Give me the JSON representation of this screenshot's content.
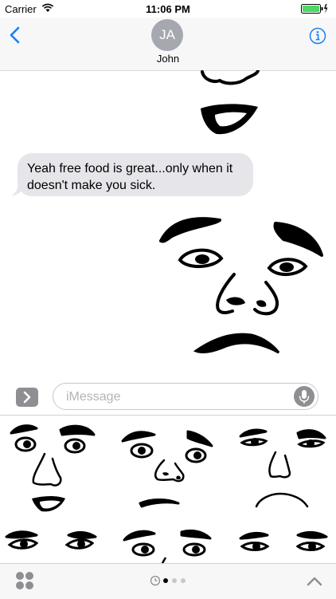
{
  "status_bar": {
    "carrier": "Carrier",
    "time": "11:06 PM"
  },
  "nav": {
    "avatar_initials": "JA",
    "contact_name": "John"
  },
  "messages": [
    {
      "from": "contact",
      "text": "Yeah free food is great...only when it doesn't make you sick."
    }
  ],
  "input": {
    "placeholder": "iMessage"
  },
  "icons": {
    "back": "chevron-left-icon",
    "info": "info-icon",
    "apps": "chevron-right-icon",
    "mic": "microphone-icon",
    "grid": "app-grid-icon",
    "recents": "clock-icon",
    "expand": "chevron-up-icon"
  },
  "colors": {
    "accent": "#1a7ef7",
    "bubble": "#e5e5ea",
    "battery": "#4cd964"
  }
}
